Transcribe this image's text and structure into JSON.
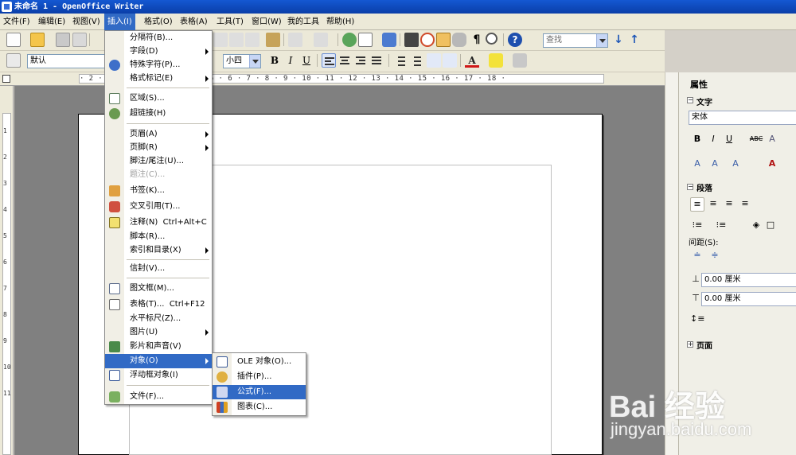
{
  "window": {
    "title": "未命名 1 - OpenOffice Writer"
  },
  "menubar": [
    {
      "label": "文件(F)"
    },
    {
      "label": "编辑(E)"
    },
    {
      "label": "视图(V)"
    },
    {
      "label": "插入(I)"
    },
    {
      "label": "格式(O)"
    },
    {
      "label": "表格(A)"
    },
    {
      "label": "工具(T)"
    },
    {
      "label": "窗口(W)"
    },
    {
      "label": "我的工具"
    },
    {
      "label": "帮助(H)"
    }
  ],
  "toolbar": {
    "find_placeholder": "查找",
    "paragraph_style": "默认",
    "font_size": "小四",
    "bold": "B",
    "italic": "I",
    "underline": "U",
    "font_color_letter": "A"
  },
  "ruler": {
    "horizontal_marks": "· 2 · 1 · · 1 · 2 · 3 · 4 · 5 · 6 · 7 · 8 · 9 · 10 · 11 · 12 · 13 · 14 · 15 · 16 · 17 · 18 ·",
    "vertical_marks": [
      "1",
      "2",
      "3",
      "4",
      "5",
      "6",
      "7",
      "8",
      "9",
      "10",
      "11"
    ]
  },
  "insert_menu": {
    "items": [
      {
        "label": "分隔符(B)..."
      },
      {
        "label": "字段(D)",
        "submenu": true
      },
      {
        "label": "特殊字符(P)...",
        "icon": "omega-icon"
      },
      {
        "label": "格式标记(E)",
        "submenu": true
      },
      {
        "label": "区域(S)...",
        "icon": "section-icon"
      },
      {
        "label": "超链接(H)",
        "icon": "hyperlink-icon"
      },
      {
        "label": "页眉(A)",
        "submenu": true
      },
      {
        "label": "页脚(R)",
        "submenu": true
      },
      {
        "label": "脚注/尾注(U)..."
      },
      {
        "label": "题注(C)...",
        "disabled": true
      },
      {
        "label": "书签(K)...",
        "icon": "bookmark-icon"
      },
      {
        "label": "交叉引用(T)...",
        "icon": "cross-reference-icon"
      },
      {
        "label": "注释(N)",
        "shortcut": "Ctrl+Alt+C",
        "icon": "comment-icon"
      },
      {
        "label": "脚本(R)..."
      },
      {
        "label": "索引和目录(X)",
        "submenu": true
      },
      {
        "label": "信封(V)..."
      },
      {
        "label": "图文框(M)...",
        "icon": "frame-icon"
      },
      {
        "label": "表格(T)...",
        "shortcut": "Ctrl+F12",
        "icon": "table-icon"
      },
      {
        "label": "水平标尺(Z)..."
      },
      {
        "label": "图片(U)",
        "submenu": true
      },
      {
        "label": "影片和声音(V)",
        "icon": "movie-icon"
      },
      {
        "label": "对象(O)",
        "submenu": true,
        "highlighted": true
      },
      {
        "label": "浮动框对象(I)",
        "icon": "floating-frame-icon"
      },
      {
        "label": "文件(F)...",
        "icon": "file-icon"
      }
    ]
  },
  "object_submenu": {
    "items": [
      {
        "label": "OLE 对象(O)...",
        "icon": "ole-icon"
      },
      {
        "label": "插件(P)...",
        "icon": "plugin-icon"
      },
      {
        "label": "公式(F)...",
        "icon": "formula-icon",
        "highlighted": true
      },
      {
        "label": "图表(C)...",
        "icon": "chart-icon"
      }
    ]
  },
  "sidebar": {
    "title": "属性",
    "text_section": "文字",
    "font_name": "宋体",
    "paragraph_section": "段落",
    "spacing_label": "间距(S):",
    "above_spacing": "0.00 厘米",
    "below_spacing": "0.00 厘米",
    "page_section": "页面"
  },
  "watermark": {
    "brand": "Bai 经验",
    "url": "jingyan.baidu.com"
  },
  "colors": {
    "menu_highlight": "#316ac5",
    "titlebar": "#0a3ea8"
  }
}
